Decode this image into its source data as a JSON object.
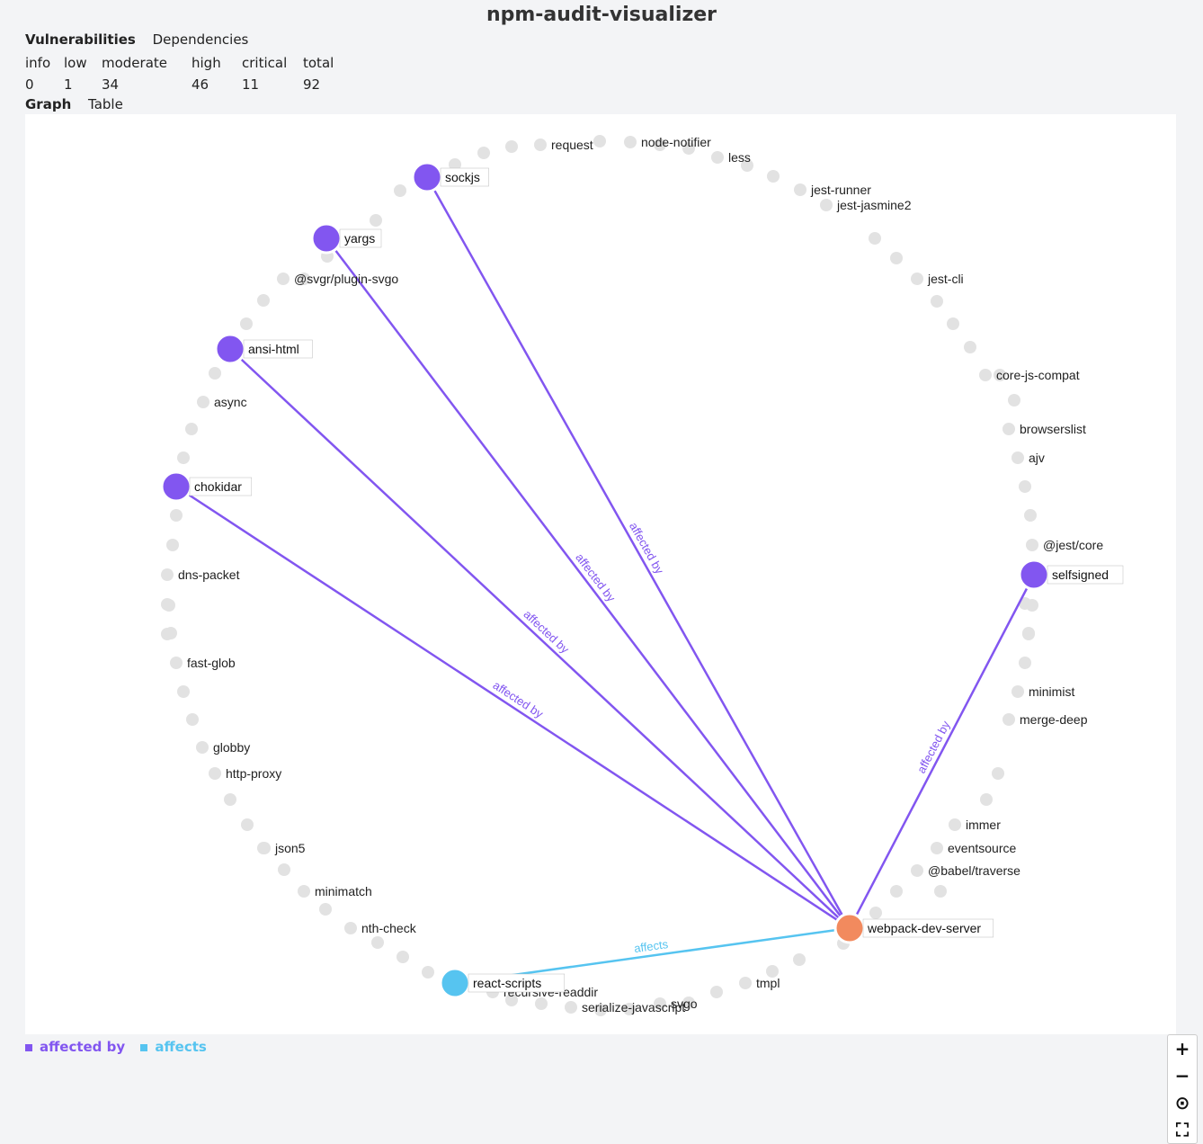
{
  "app_title": "npm-audit-visualizer",
  "top_tabs": [
    "Vulnerabilities",
    "Dependencies"
  ],
  "view_tabs": [
    "Graph",
    "Table"
  ],
  "severity": {
    "headers": [
      "info",
      "low",
      "moderate",
      "high",
      "critical",
      "total"
    ],
    "values": [
      "0",
      "1",
      "34",
      "46",
      "11",
      "92"
    ]
  },
  "colors": {
    "affected_by": "#8256f0",
    "affects": "#56c4f0",
    "root": "#f28a5e",
    "node": "#e2e2e2"
  },
  "graph": {
    "center_node": "webpack-dev-server",
    "vulnerable_nodes": [
      "sockjs",
      "yargs",
      "ansi-html",
      "chokidar",
      "selfsigned"
    ],
    "dependent_nodes": [
      "react-scripts"
    ],
    "edge_labels": {
      "affected_by": "affected by",
      "affects": "affects"
    },
    "labeled_nodes": [
      "request",
      "node-notifier",
      "less",
      "jest-runner",
      "jest-jasmine2",
      "jest-cli",
      "core-js-compat",
      "browserslist",
      "ajv",
      "@jest/core",
      "minimist",
      "merge-deep",
      "immer",
      "eventsource",
      "@babel/traverse",
      "tmpl",
      "svgo",
      "serialize-javascript",
      "recursive-readdir",
      "nth-check",
      "minimatch",
      "json5",
      "http-proxy",
      "globby",
      "fast-glob",
      "dns-packet",
      "async",
      "@svgr/plugin-svgo"
    ]
  },
  "zoom_controls": [
    "+",
    "−",
    "⊙",
    "⛶"
  ],
  "legend": [
    "affected by",
    "affects"
  ]
}
